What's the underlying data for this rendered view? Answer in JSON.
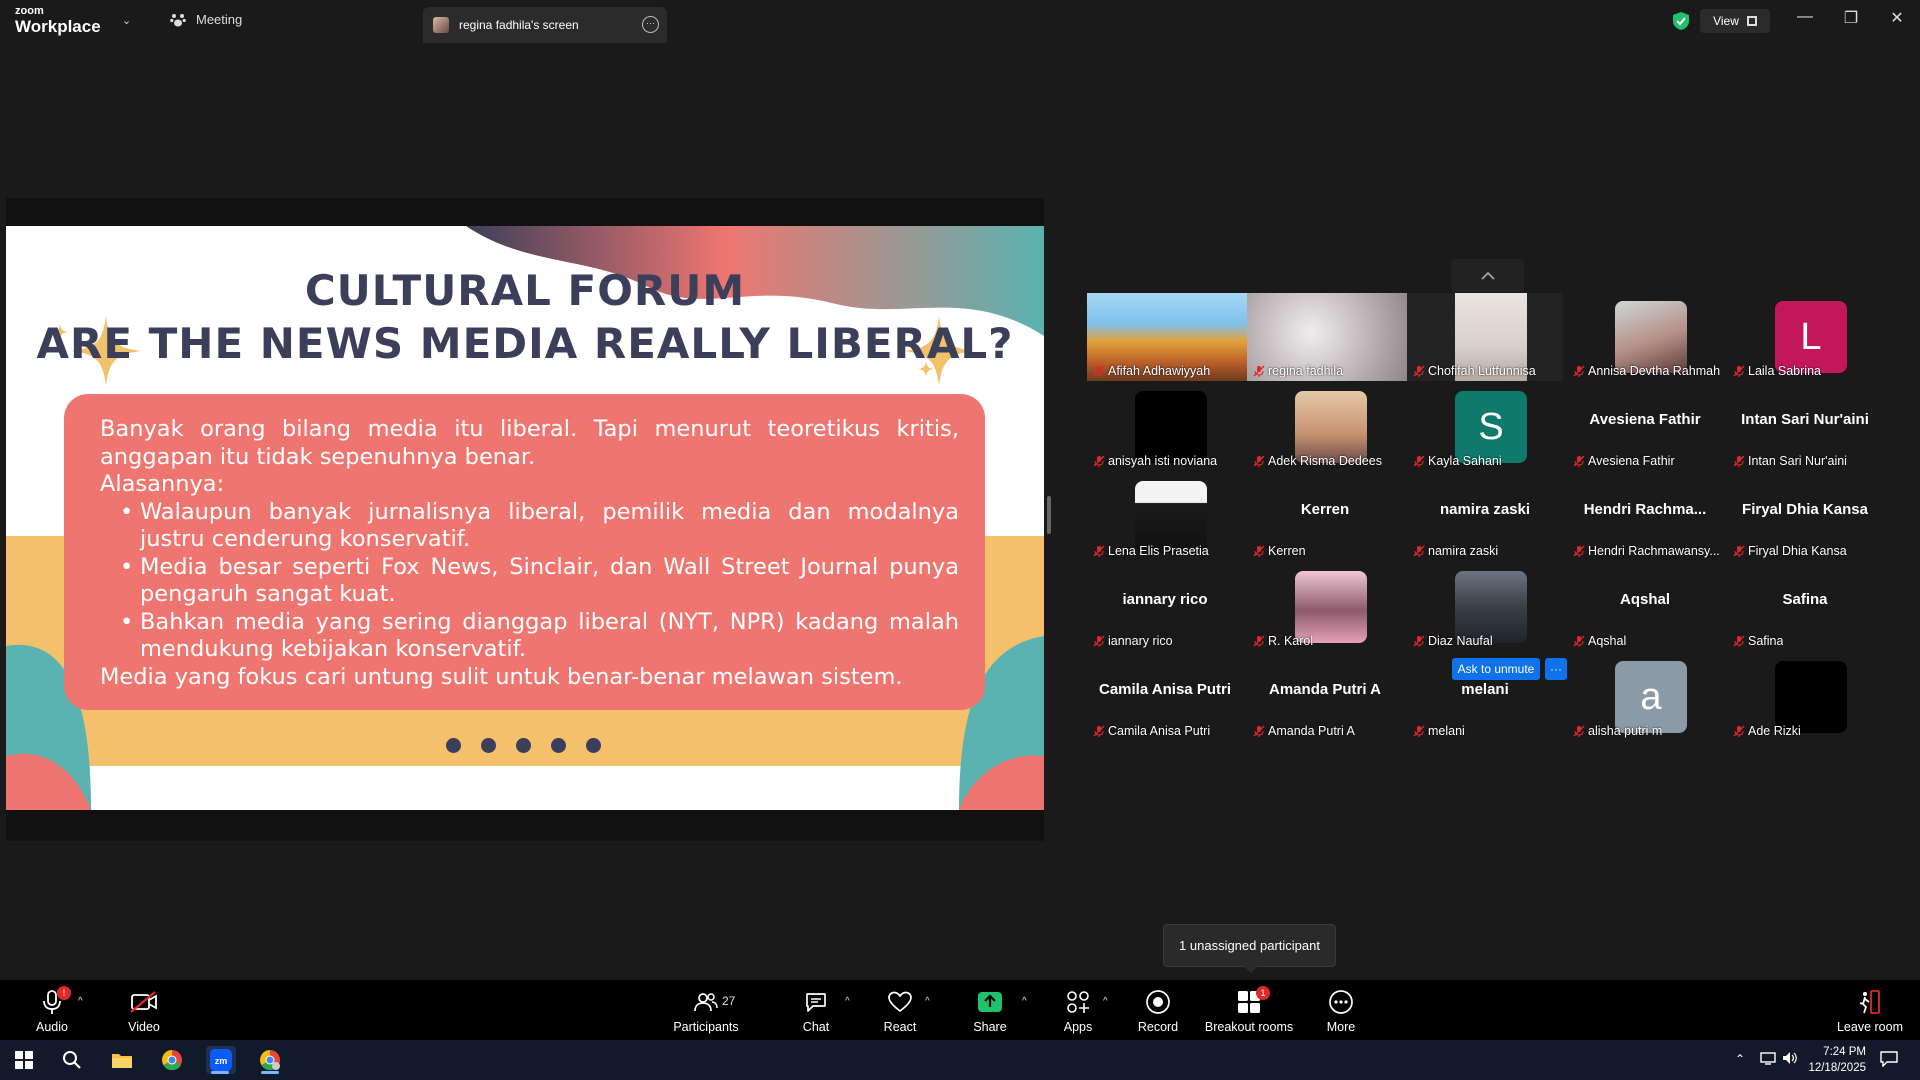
{
  "titlebar": {
    "logo_top": "zoom",
    "logo_bottom": "Workplace",
    "meeting_tab": "Meeting",
    "screen_tab": "regina fadhila's screen",
    "view_label": "View"
  },
  "slide": {
    "title_line1": "CULTURAL FORUM",
    "title_line2": "ARE THE NEWS MEDIA REALLY LIBERAL?",
    "intro": "Banyak orang bilang media itu liberal. Tapi menurut teoretikus kritis, anggapan itu tidak sepenuhnya benar.",
    "reasons_heading": "Alasannya:",
    "bullets": [
      "Walaupun banyak jurnalisnya liberal, pemilik media dan modalnya justru cenderung konservatif.",
      "Media besar seperti Fox News, Sinclair, dan Wall Street Journal punya pengaruh sangat kuat.",
      "Bahkan media yang sering dianggap liberal (NYT, NPR) kadang malah mendukung kebijakan konservatif."
    ],
    "closing": "Media yang fokus cari untung sulit untuk benar-benar melawan sistem."
  },
  "participants": [
    {
      "name": "Afifah Adhawiyyah",
      "type": "video"
    },
    {
      "name": "regina fadhila",
      "type": "video"
    },
    {
      "name": "Chofifah Lutfunnisa",
      "type": "video"
    },
    {
      "name": "Annisa Devtha Rahmah",
      "type": "photo"
    },
    {
      "name": "Laila Sabrina",
      "type": "letter",
      "letter": "L",
      "color": "#c2185b"
    },
    {
      "name": "anisyah isti noviana",
      "type": "black"
    },
    {
      "name": "Adek Risma Dedees",
      "type": "photo"
    },
    {
      "name": "Kayla Sahani",
      "type": "letter",
      "letter": "S",
      "color": "#0f7a6c"
    },
    {
      "name": "Avesiena Fathir",
      "type": "name",
      "big": "Avesiena Fathir"
    },
    {
      "name": "Intan Sari Nur'aini",
      "type": "name",
      "big": "Intan Sari Nur'aini"
    },
    {
      "name": "Lena Elis Prasetia",
      "type": "photo"
    },
    {
      "name": "Kerren",
      "type": "name",
      "big": "Kerren"
    },
    {
      "name": "namira zaski",
      "type": "name",
      "big": "namira zaski"
    },
    {
      "name": "Hendri Rachmawansy...",
      "type": "name",
      "big": "Hendri  Rachma..."
    },
    {
      "name": "Firyal Dhia Kansa",
      "type": "name",
      "big": "Firyal Dhia Kansa"
    },
    {
      "name": "iannary rico",
      "type": "name",
      "big": "iannary rico"
    },
    {
      "name": "R. Karol",
      "type": "photo"
    },
    {
      "name": "Diaz Naufal",
      "type": "photo"
    },
    {
      "name": "Aqshal",
      "type": "name",
      "big": "Aqshal"
    },
    {
      "name": "Safina",
      "type": "name",
      "big": "Safina"
    },
    {
      "name": "Camila Anisa Putri",
      "type": "name",
      "big": "Camila Anisa Putri"
    },
    {
      "name": "Amanda Putri A",
      "type": "name",
      "big": "Amanda Putri A"
    },
    {
      "name": "melani",
      "type": "name",
      "big": "melani"
    },
    {
      "name": "alisha putri m",
      "type": "letter",
      "letter": "a",
      "color": "#8a9aa6"
    },
    {
      "name": "Ade Rizki",
      "type": "black"
    }
  ],
  "ask_to_unmute": "Ask to unmute",
  "ask_more": "···",
  "tooltip": "1 unassigned participant",
  "toolbar": {
    "audio": "Audio",
    "video": "Video",
    "participants": "Participants",
    "participants_count": "27",
    "chat": "Chat",
    "react": "React",
    "share": "Share",
    "apps": "Apps",
    "record": "Record",
    "breakout": "Breakout rooms",
    "breakout_badge": "1",
    "more": "More",
    "leave": "Leave room",
    "audio_badge": "!"
  },
  "taskbar": {
    "time": "7:24 PM",
    "date": "12/18/2025"
  },
  "colors": {
    "share_green": "#1fc16b",
    "slide_coral": "#ef7670",
    "slide_navy": "#3c3f5a",
    "slide_yellow": "#f4c06b",
    "slide_teal": "#5ab3b0",
    "ask_blue": "#0e72ed"
  }
}
